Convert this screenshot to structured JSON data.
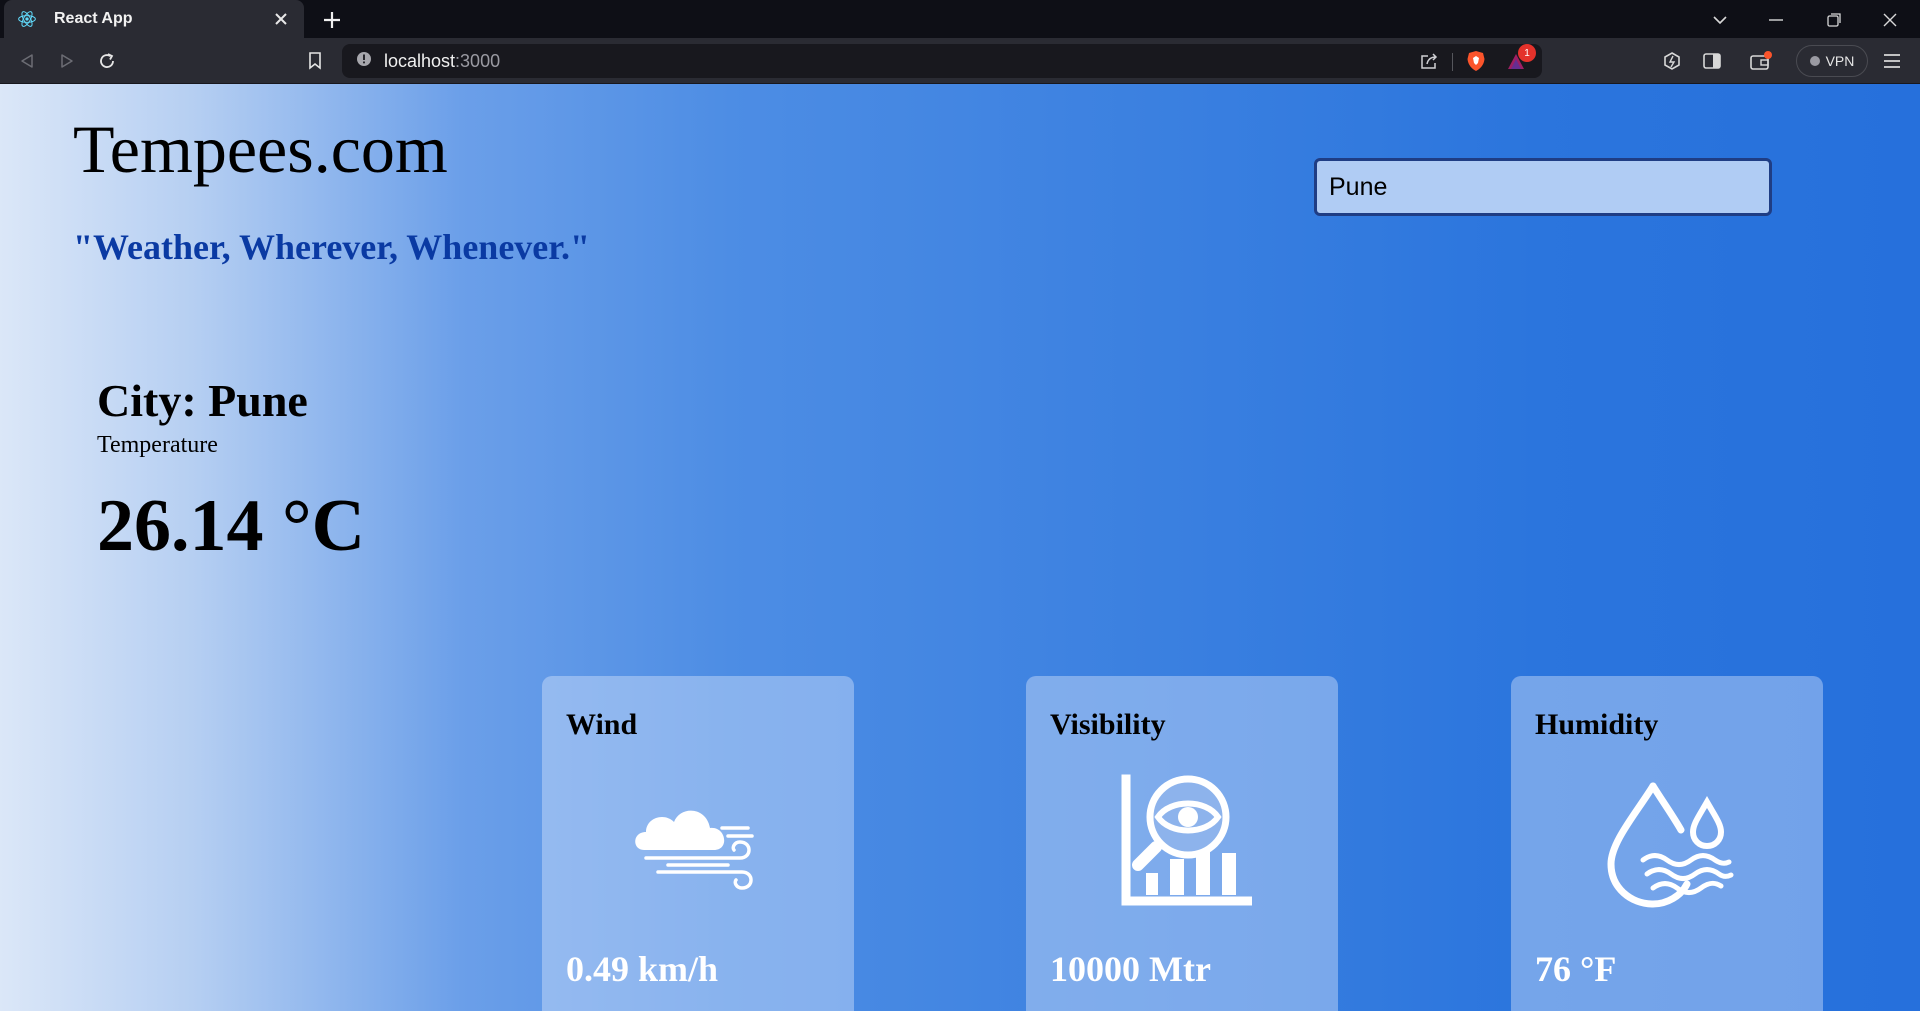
{
  "browser": {
    "tab_title": "React App",
    "url_host": "localhost",
    "url_port": ":3000",
    "vpn_label": "VPN",
    "notification_count": "1"
  },
  "page": {
    "brand": "Tempees.com",
    "tagline": "\"Weather, Wherever, Whenever.\"",
    "search_value": "Pune",
    "city": "City: Pune",
    "temperature_label": "Temperature",
    "temperature_value": "26.14 °C",
    "cards": [
      {
        "title": "Wind",
        "value": "0.49 km/h",
        "icon": "wind-cloud-icon"
      },
      {
        "title": "Visibility",
        "value": "10000 Mtr",
        "icon": "visibility-eye-chart-icon"
      },
      {
        "title": "Humidity",
        "value": "76 °F",
        "icon": "humidity-drop-icon"
      }
    ]
  },
  "colors": {
    "tagline": "#0a3aa3",
    "search_bg": "#b0ccf4",
    "search_border": "#1f3d84",
    "card_value": "#ffffff"
  }
}
